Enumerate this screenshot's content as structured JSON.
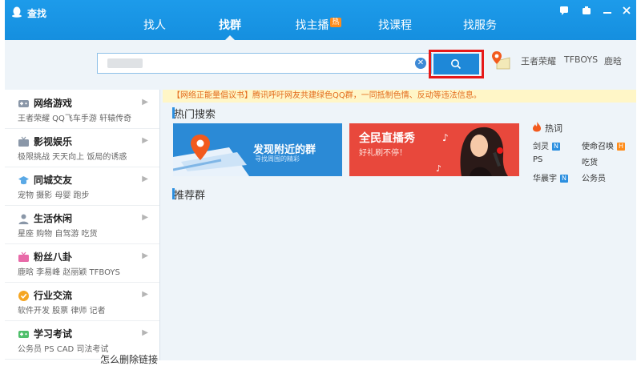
{
  "window": {
    "title": "查找"
  },
  "nav": {
    "tabs": [
      {
        "label": "找人"
      },
      {
        "label": "找群"
      },
      {
        "label": "找主播",
        "badge": "热"
      },
      {
        "label": "找课程"
      },
      {
        "label": "找服务"
      }
    ],
    "active_tab": "找群"
  },
  "search": {
    "value": "",
    "button_icon": "search-icon"
  },
  "quick_tags": [
    "王者荣耀",
    "TFBOYS",
    "鹿晗"
  ],
  "notice": "【网络正能量倡议书】腾讯呼吁网友共建绿色QQ群，一同抵制色情、反动等违法信息。",
  "sidebar": {
    "categories": [
      {
        "title": "网络游戏",
        "sub": "王者荣耀  QQ飞车手游  轩辕传奇",
        "icon": "gamepad-icon"
      },
      {
        "title": "影视娱乐",
        "sub": "极限挑战  天天向上  饭局的诱惑",
        "icon": "tv-icon"
      },
      {
        "title": "同城交友",
        "sub": "宠物  摄影  母婴  跑步",
        "icon": "graduation-cap-icon"
      },
      {
        "title": "生活休闲",
        "sub": "星座  购物  自驾游  吃货",
        "icon": "person-icon"
      },
      {
        "title": "粉丝八卦",
        "sub": "鹿晗  李易峰  赵丽颖  TFBOYS",
        "icon": "tv-pink-icon"
      },
      {
        "title": "行业交流",
        "sub": "软件开发  股票  律师  记者",
        "icon": "verified-badge-icon"
      },
      {
        "title": "学习考试",
        "sub": "公务员  PS  CAD  司法考试",
        "icon": "gamepad-green-icon"
      }
    ]
  },
  "main": {
    "hot_search_title": "热门搜索",
    "recommend_title": "推荐群",
    "banners": [
      {
        "title": "发现附近的群",
        "sub": "寻找周围的精彩"
      },
      {
        "title": "全民直播秀",
        "sub": "好礼刷不停！"
      }
    ],
    "hotwords_title": "热词",
    "hotwords": [
      {
        "label": "剑灵",
        "badge": "N"
      },
      {
        "label": "使命召唤",
        "badge": "H"
      },
      {
        "label": "PS",
        "badge": ""
      },
      {
        "label": "吃货",
        "badge": ""
      },
      {
        "label": "华晨宇",
        "badge": "N"
      },
      {
        "label": "公务员",
        "badge": ""
      }
    ]
  },
  "background_text": "怎么删除链接",
  "colors": {
    "titlebar": "#1d9bea",
    "search_button": "#1e88d8",
    "highlight_frame": "#e61919",
    "banner_blue": "#2b8ad6",
    "banner_red": "#e8483c",
    "notice_text": "#e36b1b"
  }
}
